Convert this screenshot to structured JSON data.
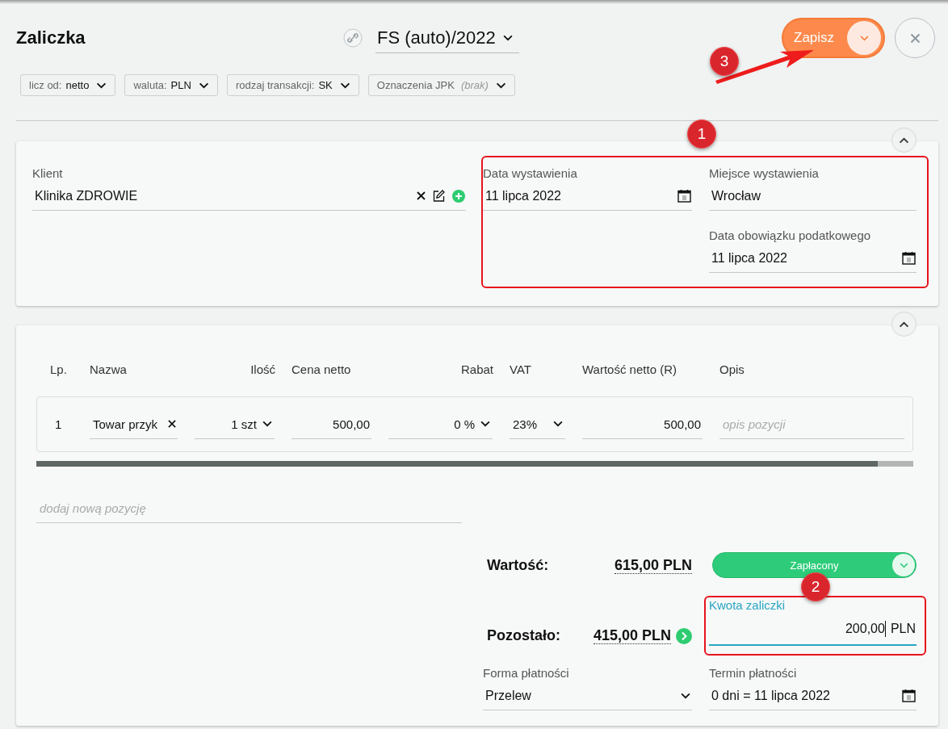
{
  "header": {
    "title": "Zaliczka",
    "numbering": "FS (auto)/2022",
    "save_label": "Zapisz"
  },
  "options": [
    {
      "label": "licz od:",
      "value": "netto",
      "kind": "value"
    },
    {
      "label": "waluta:",
      "value": "PLN",
      "kind": "value"
    },
    {
      "label": "rodzaj transakcji:",
      "value": "SK",
      "kind": "value"
    },
    {
      "label": "Oznaczenia JPK",
      "value": "(brak)",
      "kind": "empty"
    }
  ],
  "details": {
    "client": {
      "label": "Klient",
      "value": "Klinika ZDROWIE"
    },
    "issue_date": {
      "label": "Data wystawienia",
      "value": "11 lipca 2022"
    },
    "place": {
      "label": "Miejsce wystawienia",
      "value": "Wrocław"
    },
    "tax_date": {
      "label": "Data obowiązku podatkowego",
      "value": "11 lipca 2022"
    }
  },
  "items": {
    "columns": [
      "Lp.",
      "Nazwa",
      "Ilość",
      "Cena netto",
      "Rabat",
      "VAT",
      "Wartość netto (R)",
      "Opis"
    ],
    "rows": [
      {
        "lp": "1",
        "name": "Towar przyk",
        "quantity": "1 szt",
        "net_price": "500,00",
        "discount": "0 %",
        "vat": "23%",
        "net_value": "500,00",
        "description_placeholder": "opis pozycji"
      }
    ],
    "add_placeholder": "dodaj nową pozycję"
  },
  "summary": {
    "value_label": "Wartość:",
    "value": "615,00 PLN",
    "status": "Zapłacony",
    "remaining_label": "Pozostało:",
    "remaining": "415,00 PLN",
    "advance": {
      "label": "Kwota zaliczki",
      "value": "200,00",
      "currency": "PLN",
      "focused": true
    },
    "payment_method": {
      "label": "Forma płatności",
      "value": "Przelew"
    },
    "payment_due": {
      "label": "Termin płatności",
      "value": "0 dni = 11 lipca 2022"
    }
  },
  "annotations": [
    {
      "label": "1",
      "kind": "box"
    },
    {
      "label": "2",
      "kind": "box"
    },
    {
      "label": "3",
      "kind": "arrow"
    }
  ]
}
